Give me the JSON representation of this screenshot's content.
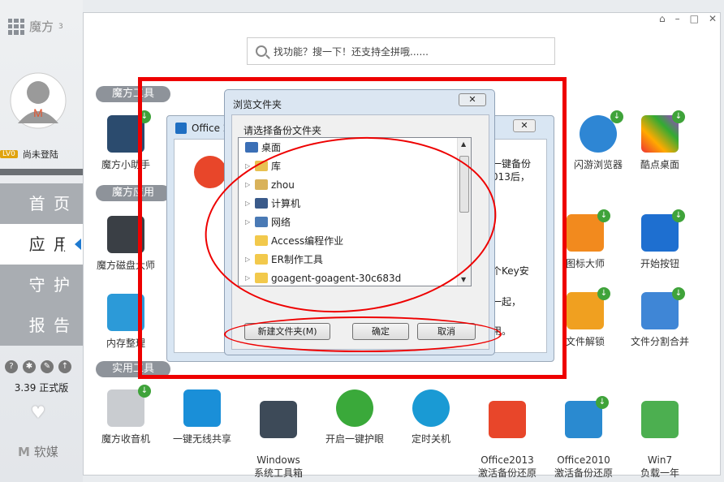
{
  "sidebar": {
    "logo": "魔方",
    "logo_sup": "3",
    "level": "LV0",
    "user_status": "尚未登陆",
    "nav": [
      "首 页",
      "应 用",
      "守 护",
      "报 告"
    ],
    "version": "3.39 正式版",
    "brand": "软媒"
  },
  "search": {
    "placeholder": "找功能？搜一下！还支持全拼哦......"
  },
  "sections": {
    "tools": "魔方工具",
    "apps": "魔方应用",
    "practical": "实用工具"
  },
  "apps": {
    "helper": "魔方小助手",
    "disk": "魔方磁盘大师",
    "memory": "内存整理",
    "browser": "闪游浏览器",
    "cool_desktop": "酷点桌面",
    "icon_master": "图标大师",
    "start_button": "开始按钮",
    "file_unlock": "文件解锁",
    "file_split": "文件分割合并"
  },
  "bottom_apps": [
    {
      "label": "魔方收音机"
    },
    {
      "label": "一键无线共享"
    },
    {
      "label": "Windows\n系统工具箱"
    },
    {
      "label": "开启一键护眼"
    },
    {
      "label": "定时关机"
    },
    {
      "label": "Office2013\n激活备份还原"
    },
    {
      "label": "Office2010\n激活备份还原"
    },
    {
      "label": "Win7\n负载一年"
    }
  ],
  "back_dialog": {
    "title": "Office 2",
    "text1": "一键备份",
    "text2": "013后，",
    "text3": "个Key安",
    "text4": "一起，",
    "text5": "用。"
  },
  "dialog": {
    "title": "浏览文件夹",
    "prompt": "请选择备份文件夹",
    "tree": [
      "桌面",
      "库",
      "zhou",
      "计算机",
      "网络",
      "Access编程作业",
      "ER制作工具",
      "goagent-goagent-30c683d"
    ],
    "new_folder": "新建文件夹(M)",
    "ok": "确定",
    "cancel": "取消"
  },
  "colors": {
    "accent_red": "#e00000",
    "nav_active_arrow": "#1f7ad0"
  }
}
